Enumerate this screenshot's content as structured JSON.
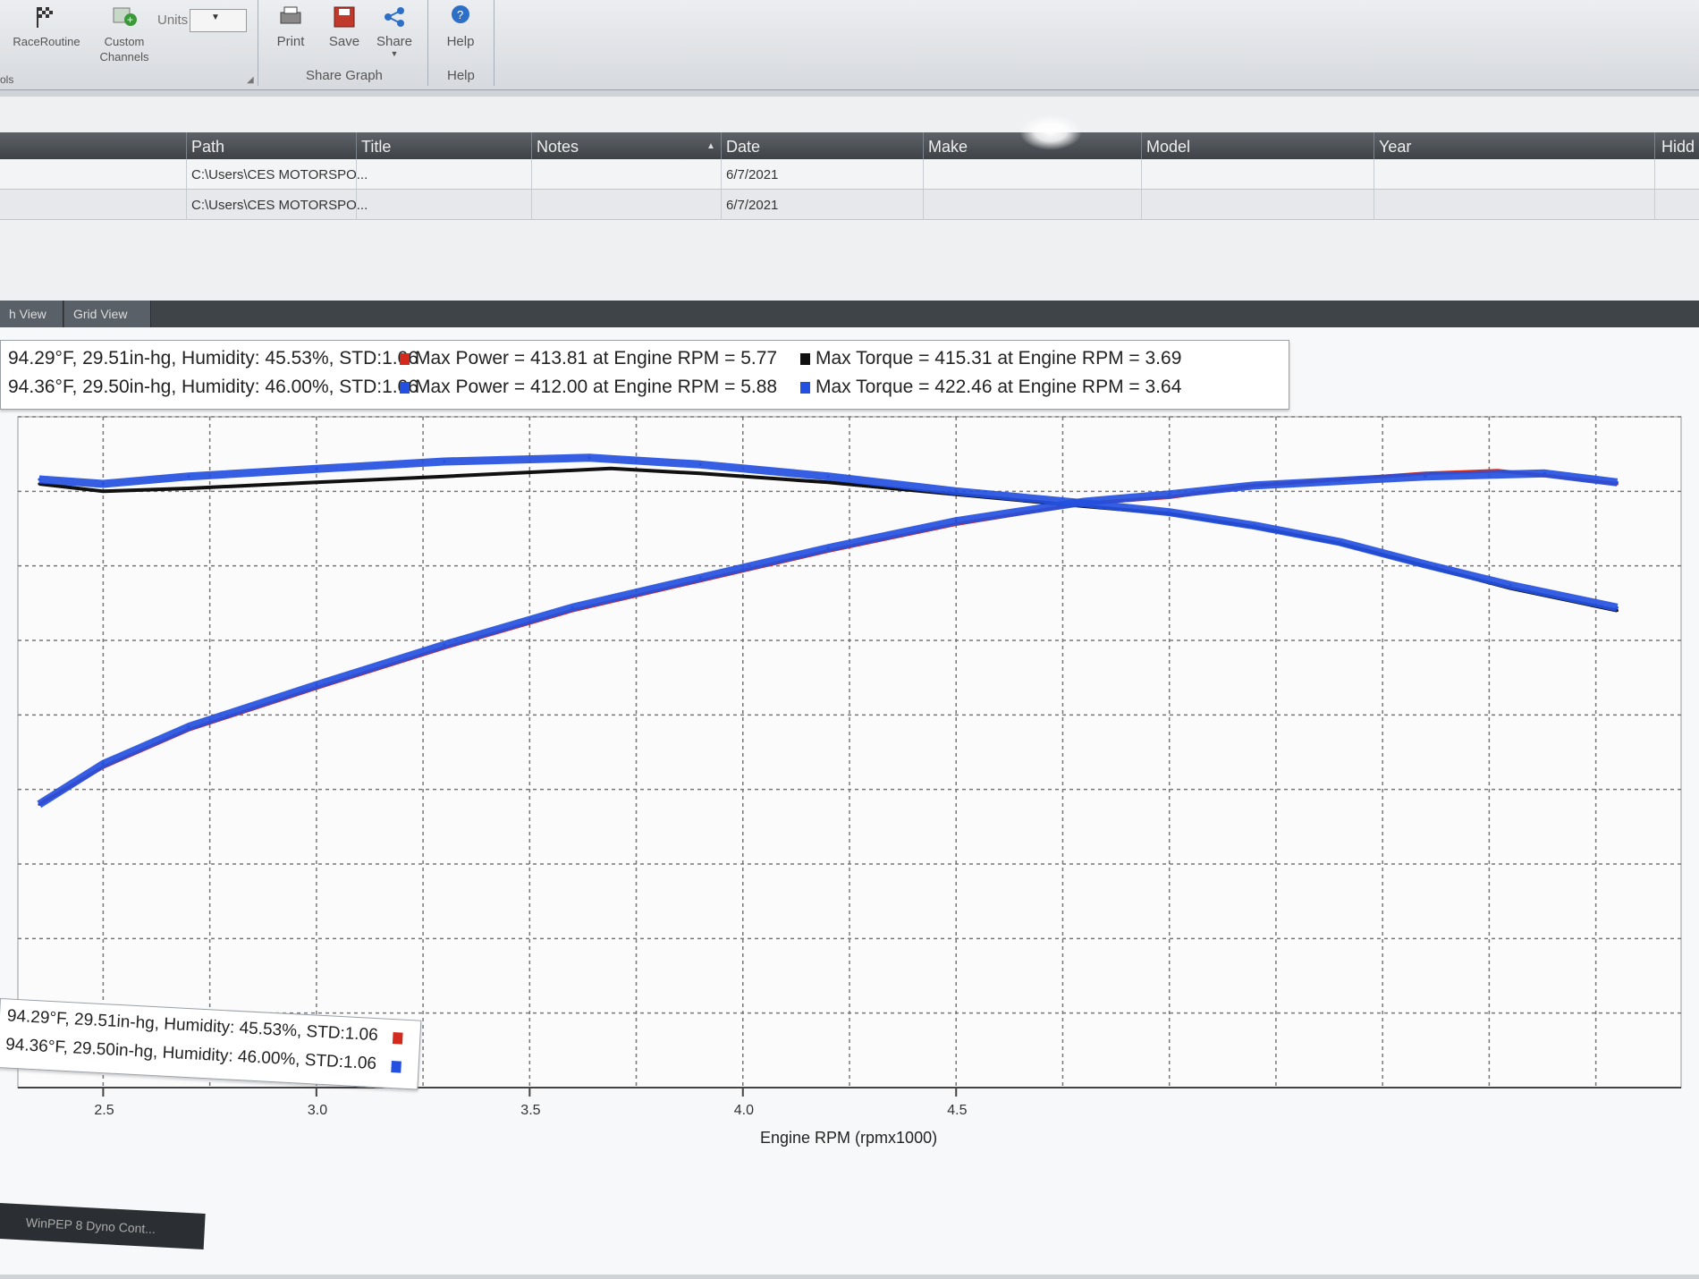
{
  "ribbon": {
    "raceroutine_label": "RaceRoutine",
    "custom_channels_label": "Custom\nChannels",
    "units_label": "Units",
    "units_value": "",
    "print_label": "Print",
    "save_label": "Save",
    "share_label": "Share",
    "share_graph_group": "Share Graph",
    "help_label": "Help",
    "help_group": "Help",
    "tools_group_partial": "ols"
  },
  "table": {
    "columns": [
      "Path",
      "Title",
      "Notes",
      "Date",
      "Make",
      "Model",
      "Year",
      "Hidd"
    ],
    "rows": [
      {
        "path": "C:\\Users\\CES MOTORSPO...",
        "title": "",
        "notes": "",
        "date": "6/7/2021",
        "make": "",
        "model": "",
        "year": ""
      },
      {
        "path": "C:\\Users\\CES MOTORSPO...",
        "title": "",
        "notes": "",
        "date": "6/7/2021",
        "make": "",
        "model": "",
        "year": ""
      }
    ]
  },
  "tabs": [
    "h View",
    "Grid View"
  ],
  "legend_top": {
    "run1_conditions": "94.29°F, 29.51in-hg, Humidity: 45.53%, STD:1.06",
    "run2_conditions": "94.36°F, 29.50in-hg, Humidity: 46.00%, STD:1.06",
    "run1_power": "Max Power = 413.81 at Engine RPM = 5.77",
    "run2_power": "Max Power = 412.00 at Engine RPM = 5.88",
    "run1_torque": "Max Torque = 415.31 at Engine RPM = 3.69",
    "run2_torque": "Max Torque = 422.46 at Engine RPM = 3.64"
  },
  "legend_bottom": {
    "run1": "94.29°F, 29.51in-hg, Humidity: 45.53%, STD:1.06",
    "run2": "94.36°F, 29.50in-hg, Humidity: 46.00%, STD:1.06"
  },
  "taskbar": {
    "item": "WinPEP 8 Dyno Cont..."
  },
  "colors": {
    "run1_power": "#d42a1e",
    "run1_torque": "#111111",
    "run2": "#2450e0"
  },
  "chart_data": {
    "type": "line",
    "xlabel": "Engine RPM (rpmx1000)",
    "x_ticks": [
      "2.5",
      "3.0",
      "3.5",
      "4.0",
      "4.5"
    ],
    "xlim": [
      2.3,
      6.2
    ],
    "ylim": [
      0,
      450
    ],
    "grid": true,
    "series": [
      {
        "name": "Max Power = 413.81 at Engine RPM = 5.77",
        "color": "#d42a1e",
        "x": [
          2.35,
          2.5,
          2.7,
          3.0,
          3.3,
          3.6,
          3.9,
          4.2,
          4.5,
          4.8,
          5.0,
          5.2,
          5.4,
          5.6,
          5.77,
          5.9,
          6.05
        ],
        "y": [
          190,
          215,
          240,
          268,
          295,
          320,
          340,
          360,
          378,
          392,
          396,
          404,
          408,
          412,
          413.8,
          410,
          405
        ]
      },
      {
        "name": "Max Torque = 415.31 at Engine RPM = 3.69",
        "color": "#111111",
        "x": [
          2.35,
          2.5,
          2.7,
          3.0,
          3.3,
          3.69,
          3.9,
          4.2,
          4.5,
          4.8,
          5.0,
          5.2,
          5.4,
          5.6,
          5.8,
          6.05
        ],
        "y": [
          405,
          400,
          402,
          406,
          410,
          415.3,
          412,
          406,
          398,
          390,
          385,
          376,
          365,
          350,
          335,
          320
        ]
      },
      {
        "name": "Max Power = 412.00 at Engine RPM = 5.88",
        "color": "#2450e0",
        "x": [
          2.35,
          2.5,
          2.7,
          3.0,
          3.3,
          3.6,
          3.9,
          4.2,
          4.5,
          4.8,
          5.0,
          5.2,
          5.4,
          5.6,
          5.88,
          6.05
        ],
        "y": [
          190,
          217,
          242,
          270,
          297,
          322,
          342,
          362,
          380,
          393,
          398,
          404,
          407,
          410,
          412,
          406
        ]
      },
      {
        "name": "Max Torque = 422.46 at Engine RPM = 3.64",
        "color": "#2450e0",
        "x": [
          2.35,
          2.5,
          2.7,
          3.0,
          3.3,
          3.64,
          3.9,
          4.2,
          4.5,
          4.8,
          5.0,
          5.2,
          5.4,
          5.6,
          5.8,
          6.05
        ],
        "y": [
          408,
          405,
          410,
          415,
          420,
          422.5,
          418,
          410,
          400,
          392,
          386,
          377,
          366,
          351,
          337,
          322
        ]
      }
    ]
  }
}
